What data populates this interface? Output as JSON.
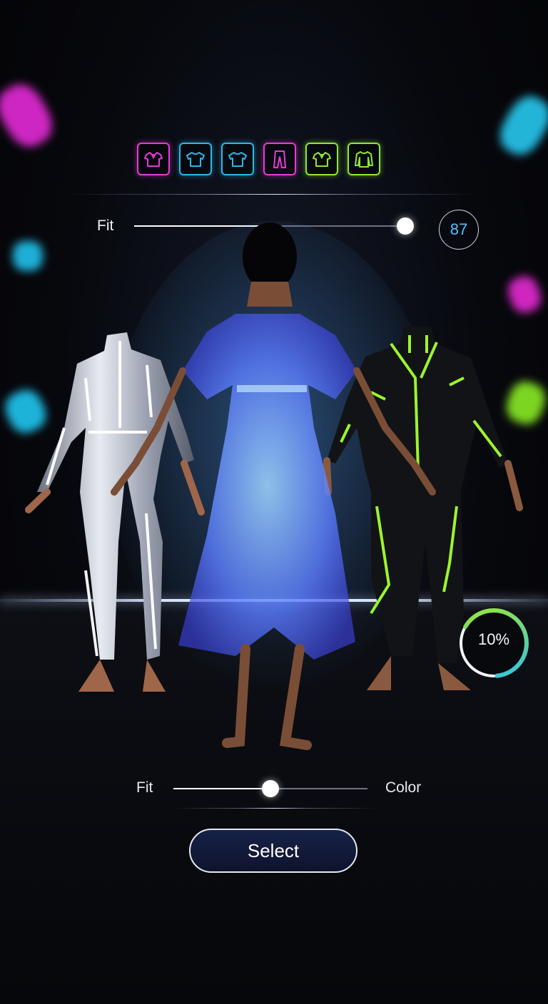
{
  "garment_icons": [
    {
      "name": "shirt-icon",
      "color": "#e63bd4"
    },
    {
      "name": "tshirt-icon",
      "color": "#2bb8e8"
    },
    {
      "name": "tshirt-icon",
      "color": "#2bb8e8"
    },
    {
      "name": "pants-icon",
      "color": "#e63bd4"
    },
    {
      "name": "shirt-icon",
      "color": "#8ee832"
    },
    {
      "name": "longsleeve-icon",
      "color": "#8ee832"
    }
  ],
  "top_slider": {
    "label": "Fit",
    "value": 87,
    "value_text": "87",
    "fill_fraction": 0.87
  },
  "progress": {
    "value": 10,
    "label": "10%",
    "ring_colors": [
      "#2bc2f0",
      "#9ee830"
    ]
  },
  "bottom_slider": {
    "left_label": "Fit",
    "right_label": "Color",
    "position_fraction": 0.5
  },
  "select_button": {
    "label": "Select"
  },
  "colors": {
    "magenta": "#e63bd4",
    "cyan": "#2bb8e8",
    "lime": "#8ee832",
    "dress": "#5b8cff",
    "silver": "#d8dce6"
  }
}
